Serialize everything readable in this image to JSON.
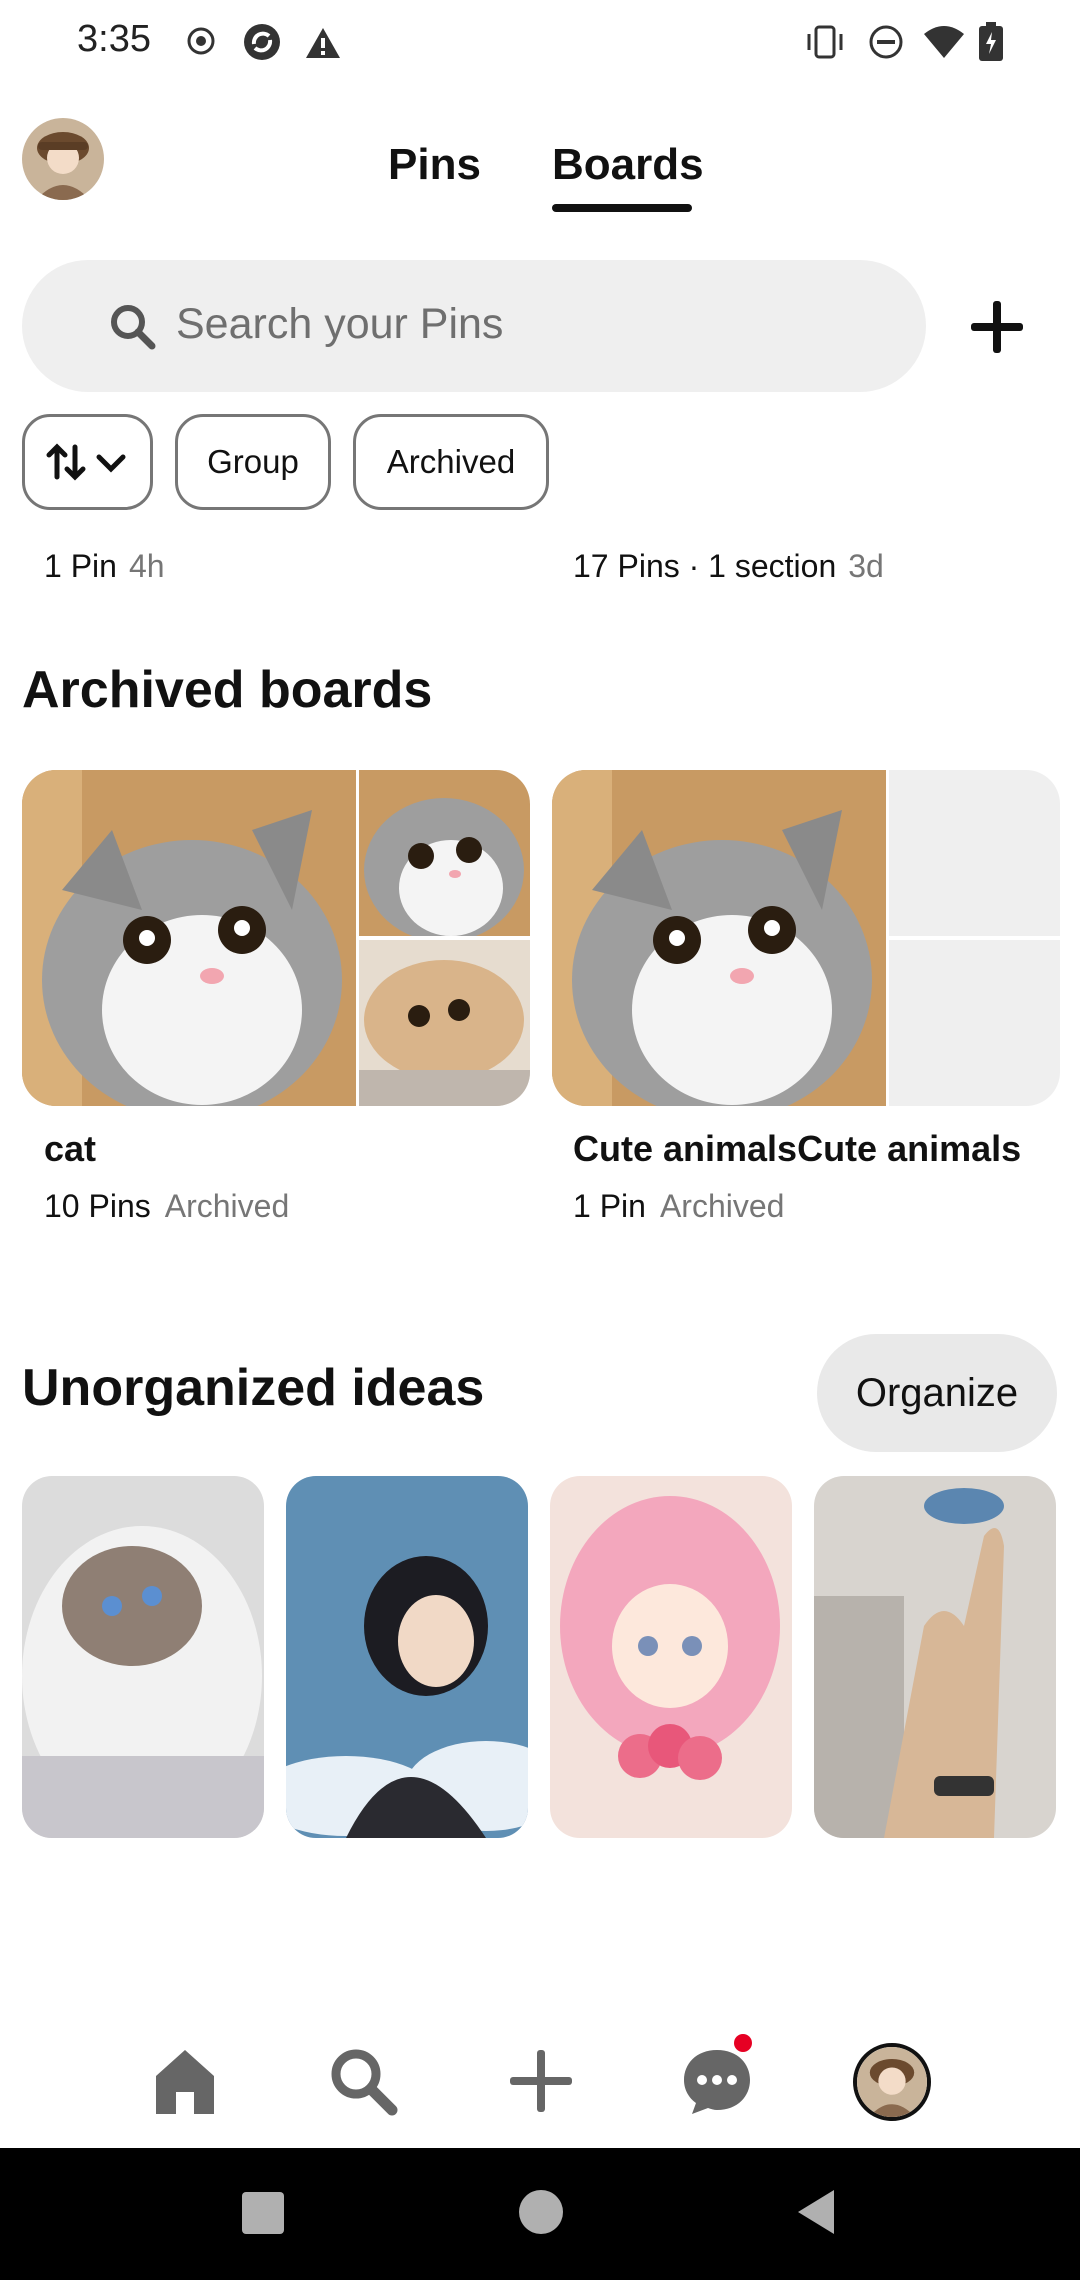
{
  "status_bar": {
    "time": "3:35",
    "left_icons": [
      "record-icon",
      "sync-icon",
      "warning-icon"
    ],
    "right_icons": [
      "vibrate-icon",
      "dnd-icon",
      "wifi-icon",
      "battery-icon"
    ]
  },
  "header": {
    "tabs": [
      {
        "label": "Pins",
        "active": false
      },
      {
        "label": "Boards",
        "active": true
      }
    ]
  },
  "search": {
    "placeholder": "Search your Pins"
  },
  "filters": {
    "sort_icon": "sort-arrows-icon",
    "chips": [
      "Group",
      "Archived"
    ]
  },
  "partial_boards": [
    {
      "count": "1 Pin",
      "time": "4h"
    },
    {
      "count": "17 Pins · 1 section",
      "time": "3d"
    }
  ],
  "archived": {
    "title": "Archived boards",
    "boards": [
      {
        "name": "cat",
        "count": "10 Pins",
        "status": "Archived"
      },
      {
        "name": "Cute animalsCute animals",
        "count": "1 Pin",
        "status": "Archived"
      }
    ]
  },
  "unorganized": {
    "title": "Unorganized ideas",
    "button": "Organize"
  },
  "bottom_nav": {
    "items": [
      "home-icon",
      "search-icon",
      "create-icon",
      "messages-icon",
      "profile-avatar"
    ],
    "notification_color": "#e60023"
  },
  "colors": {
    "accent": "#111111",
    "chip_border": "#767676",
    "search_bg": "#efefef"
  }
}
